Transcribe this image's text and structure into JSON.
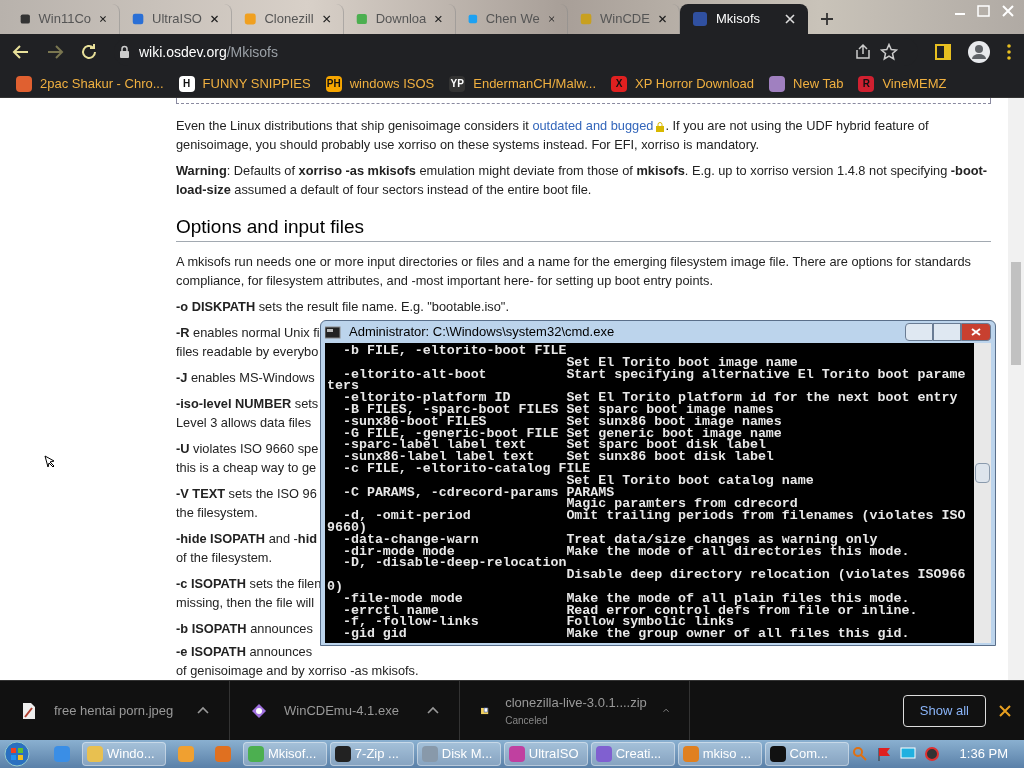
{
  "browser": {
    "tabs": [
      {
        "title": "Win11Co",
        "selected": false
      },
      {
        "title": "UltraISO",
        "selected": false
      },
      {
        "title": "Clonezill",
        "selected": false
      },
      {
        "title": "Downloa",
        "selected": false
      },
      {
        "title": "Chen We",
        "selected": false
      },
      {
        "title": "WinCDE",
        "selected": false
      },
      {
        "title": "Mkisofs",
        "selected": true
      }
    ],
    "address": {
      "host": "wiki.osdev.org",
      "path": "/Mkisofs"
    },
    "bookmarks": [
      {
        "label": "2pac Shakur - Chro...",
        "color": "#e06030"
      },
      {
        "label": "FUNNY SNIPPIES",
        "badge": "H",
        "color": "#ffffff"
      },
      {
        "label": "windows ISOS",
        "badge": "PH",
        "color": "#f7a600"
      },
      {
        "label": "EndermanCH/Malw...",
        "badge": "YP",
        "color": "#333333"
      },
      {
        "label": "XP Horror Download",
        "badge": "X",
        "color": "#e02020"
      },
      {
        "label": "New Tab",
        "color": "#a080c0"
      },
      {
        "label": "VineMEMZ",
        "badge": "R",
        "color": "#d02030"
      }
    ]
  },
  "article": {
    "link_paragraph": {
      "before": "Even the Linux distributions that ship genisoimage considers it ",
      "link": "outdated and bugged",
      "after": ". If you are not using the UDF hybrid feature of genisoimage, you should probably use xorriso on these systems instead. For EFI, xorriso is mandatory."
    },
    "intro": [
      "**Warning**: Defaults of **xorriso -as mkisofs** emulation might deviate from those of **mkisofs**. E.g. up to xorriso version 1.4.8 not specifying **-boot-load-size** assumed a default of four sectors instead of the entire boot file."
    ],
    "heading": "Options and input files",
    "body": [
      "A mkisofs run needs one or more input directories or files and a name for the emerging filesystem image file. There are options for standards compliance, for filesystem attributes, and -most important here- for setting up boot entry points.",
      "**-o DISKPATH** sets the result file name. E.g. \"bootable.iso\"."
    ],
    "partial": [
      {
        "lines": [
          "**-R** enables normal Unix fi",
          "files readable by everybo"
        ]
      },
      {
        "lines": [
          "**-J** enables MS-Windows"
        ]
      },
      {
        "lines": [
          "**-iso-level NUMBER** sets",
          "Level 3 allows data files"
        ]
      },
      {
        "lines": [
          "**-U** violates ISO 9660 spe",
          "this is a cheap way to ge"
        ]
      },
      {
        "lines": [
          "**-V TEXT** sets the ISO 96",
          "the filesystem."
        ]
      },
      {
        "lines": [
          "**-hide ISOPATH** and -**hid**",
          "of the filesystem."
        ]
      },
      {
        "lines": [
          "**-c ISOPATH** sets the filen",
          "missing, then the file will"
        ]
      },
      {
        "lines": [
          "**-b ISOPATH** announces"
        ]
      },
      {
        "lines": [
          "**-e ISOPATH** announces",
          "of genisoimage and by xorriso -as mkisofs."
        ]
      }
    ]
  },
  "console": {
    "title": "Administrator: C:\\Windows\\system32\\cmd.exe",
    "lines": [
      "  -b FILE, -eltorito-boot FILE",
      "                              Set El Torito boot image name",
      "  -eltorito-alt-boot          Start specifying alternative El Torito boot parame",
      "ters",
      "  -eltorito-platform ID       Set El Torito platform id for the next boot entry",
      "  -B FILES, -sparc-boot FILES Set sparc boot image names",
      "  -sunx86-boot FILES          Set sunx86 boot image names",
      "  -G FILE, -generic-boot FILE Set generic boot image name",
      "  -sparc-label label text     Set sparc boot disk label",
      "  -sunx86-label label text    Set sunx86 boot disk label",
      "  -c FILE, -eltorito-catalog FILE",
      "                              Set El Torito boot catalog name",
      "  -C PARAMS, -cdrecord-params PARAMS",
      "                              Magic paramters from cdrecord",
      "  -d, -omit-period            Omit trailing periods from filenames (violates ISO",
      "9660)",
      "  -data-change-warn           Treat data/size changes as warning only",
      "  -dir-mode mode              Make the mode of all directories this mode.",
      "  -D, -disable-deep-relocation",
      "                              Disable deep directory relocation (violates ISO966",
      "0)",
      "  -file-mode mode             Make the mode of all plain files this mode.",
      "  -errctl name                Read error control defs from file or inline.",
      "  -f, -follow-links           Follow symbolic links",
      "  -gid gid                    Make the group owner of all files this gid."
    ]
  },
  "downloads": {
    "items": [
      {
        "name": "free hentai porn.jpeg",
        "kind": "image"
      },
      {
        "name": "WinCDEmu-4.1.exe",
        "kind": "exe"
      },
      {
        "name": "clonezilla-live-3.0.1....zip",
        "kind": "zip",
        "status": "Canceled"
      }
    ],
    "show_all": "Show all"
  },
  "taskbar": {
    "items": [
      {
        "color": "#3a8ee6"
      },
      {
        "label": "Windo...",
        "color": "#e8c050"
      },
      {
        "color": "#f0a030"
      },
      {
        "color": "#e07020"
      },
      {
        "label": "Mkisof...",
        "color": "#4caf50"
      },
      {
        "label": "7-Zip ...",
        "color": "#222222"
      },
      {
        "label": "Disk M...",
        "color": "#8899aa"
      },
      {
        "label": "UltraISO",
        "color": "#c040a0"
      },
      {
        "label": "Creati...",
        "color": "#8060d0"
      },
      {
        "label": "mkiso ...",
        "color": "#e08020"
      },
      {
        "label": "Com...",
        "color": "#111111"
      }
    ],
    "clock": "1:36 PM"
  }
}
